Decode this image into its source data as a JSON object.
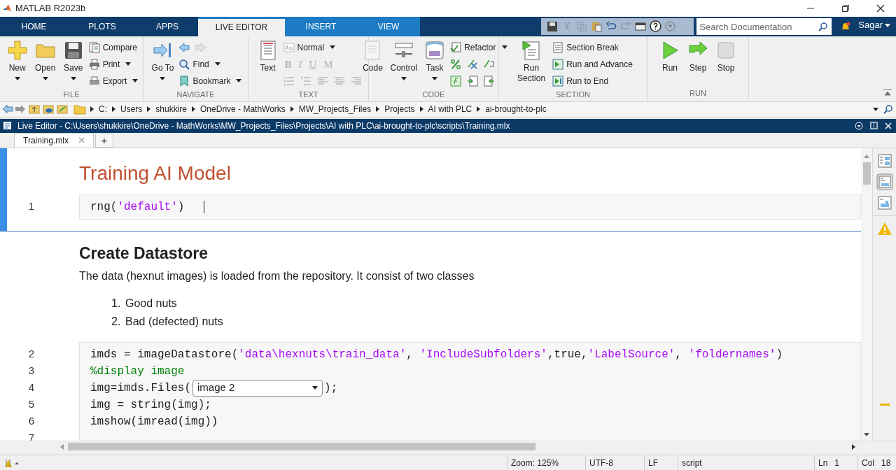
{
  "window": {
    "title": "MATLAB R2023b"
  },
  "ribbon_tabs": [
    {
      "label": "HOME",
      "kind": "standard",
      "selected": false
    },
    {
      "label": "PLOTS",
      "kind": "standard",
      "selected": false
    },
    {
      "label": "APPS",
      "kind": "standard",
      "selected": false
    },
    {
      "label": "LIVE EDITOR",
      "kind": "contextual",
      "selected": true
    },
    {
      "label": "INSERT",
      "kind": "contextual",
      "selected": false
    },
    {
      "label": "VIEW",
      "kind": "contextual",
      "selected": false
    }
  ],
  "search": {
    "placeholder": "Search Documentation"
  },
  "user": {
    "name": "Sagar"
  },
  "ribbon_groups": [
    {
      "label": "FILE",
      "items": [
        {
          "kind": "large",
          "label": "New",
          "dropdown": true
        },
        {
          "kind": "large",
          "label": "Open",
          "dropdown": true
        },
        {
          "kind": "large",
          "label": "Save",
          "dropdown": true
        },
        {
          "kind": "column",
          "rows": [
            {
              "kind": "small",
              "label": "Compare",
              "dropdown": false
            },
            {
              "kind": "small",
              "label": "Print",
              "dropdown": true
            },
            {
              "kind": "small",
              "label": "Export",
              "dropdown": true
            }
          ]
        }
      ]
    },
    {
      "label": "NAVIGATE",
      "items": [
        {
          "kind": "large",
          "label": "Go To",
          "dropdown": true
        },
        {
          "kind": "column",
          "rows": [
            {
              "kind": "icons"
            },
            {
              "kind": "small",
              "label": "Find",
              "dropdown": true
            },
            {
              "kind": "small",
              "label": "Bookmark",
              "dropdown": true
            }
          ]
        }
      ]
    },
    {
      "label": "TEXT",
      "items": [
        {
          "kind": "large",
          "label": "Text",
          "dropdown": false
        },
        {
          "kind": "column",
          "rows": [
            {
              "kind": "small",
              "label": "Normal",
              "dropdown": true
            },
            {
              "kind": "chars",
              "chars": [
                "B",
                "I",
                "U",
                "M"
              ],
              "disabled": true
            },
            {
              "kind": "icons"
            }
          ]
        }
      ]
    },
    {
      "label": "CODE",
      "items": [
        {
          "kind": "large",
          "label": "Code",
          "dropdown": false
        },
        {
          "kind": "large",
          "label": "Control",
          "dropdown": true
        },
        {
          "kind": "large",
          "label": "Task",
          "dropdown": true
        },
        {
          "kind": "column",
          "rows": [
            {
              "kind": "small",
              "label": "Refactor",
              "dropdown": true
            },
            {
              "kind": "icons"
            },
            {
              "kind": "icons"
            }
          ]
        }
      ]
    },
    {
      "label": "SECTION",
      "items": [
        {
          "kind": "large",
          "label": "Run Section",
          "dropdown": false
        },
        {
          "kind": "column",
          "rows": [
            {
              "kind": "small",
              "label": "Section Break",
              "dropdown": false
            },
            {
              "kind": "small",
              "label": "Run and Advance",
              "dropdown": false
            },
            {
              "kind": "small",
              "label": "Run to End",
              "dropdown": false
            }
          ]
        }
      ]
    },
    {
      "label": "RUN",
      "items": [
        {
          "kind": "large",
          "label": "Run",
          "dropdown": false
        },
        {
          "kind": "large",
          "label": "Step",
          "dropdown": false
        },
        {
          "kind": "large",
          "label": "Stop",
          "dropdown": false
        }
      ]
    }
  ],
  "address_bar": {
    "segments": [
      "C:",
      "Users",
      "shukkire",
      "OneDrive - MathWorks",
      "MW_Projects_Files",
      "Projects",
      "AI with PLC",
      "ai-brought-to-plc"
    ]
  },
  "editor": {
    "title": "Live Editor - C:\\Users\\shukkire\\OneDrive - MathWorks\\MW_Projects_Files\\Projects\\AI with PLC\\ai-brought-to-plc\\scripts\\Training.mlx",
    "tabs": [
      {
        "label": "Training.mlx",
        "selected": true
      }
    ],
    "new_tab": "+",
    "sections": [
      {
        "selected": true,
        "blocks": [
          {
            "kind": "title",
            "text": "Training AI Model"
          },
          {
            "kind": "code",
            "lines": [
              {
                "number": "1",
                "text": "rng('default')"
              }
            ]
          }
        ]
      },
      {
        "selected": false,
        "blocks": [
          {
            "kind": "heading",
            "text": "Create Datastore"
          },
          {
            "kind": "paragraph",
            "text": "The data (hexnut images) is loaded from the repository. It consist of two classes"
          },
          {
            "kind": "list",
            "items": [
              {
                "marker": "1.",
                "text": "Good nuts"
              },
              {
                "marker": "2.",
                "text": "Bad (defected) nuts"
              }
            ]
          },
          {
            "kind": "code",
            "lines": [
              {
                "number": "2",
                "text": "imds = imageDatastore('data\\hexnuts\\train_data', 'IncludeSubfolders',true,'LabelSource', 'foldernames')"
              },
              {
                "number": "3",
                "text": "%display image"
              },
              {
                "number": "4",
                "text": "img=imds.Files(",
                "control": "image 2",
                "after": ");"
              },
              {
                "number": "5",
                "text": "img = string(img);"
              },
              {
                "number": "6",
                "text": "imshow(imread(img))"
              },
              {
                "number": "7"
              }
            ]
          }
        ]
      }
    ]
  },
  "status_bar": {
    "fields": [
      "Zoom: 125%",
      "UTF-8",
      "LF",
      "script"
    ],
    "line": {
      "label": "Ln",
      "value": "1"
    },
    "column": {
      "label": "Col",
      "value": "18"
    }
  }
}
